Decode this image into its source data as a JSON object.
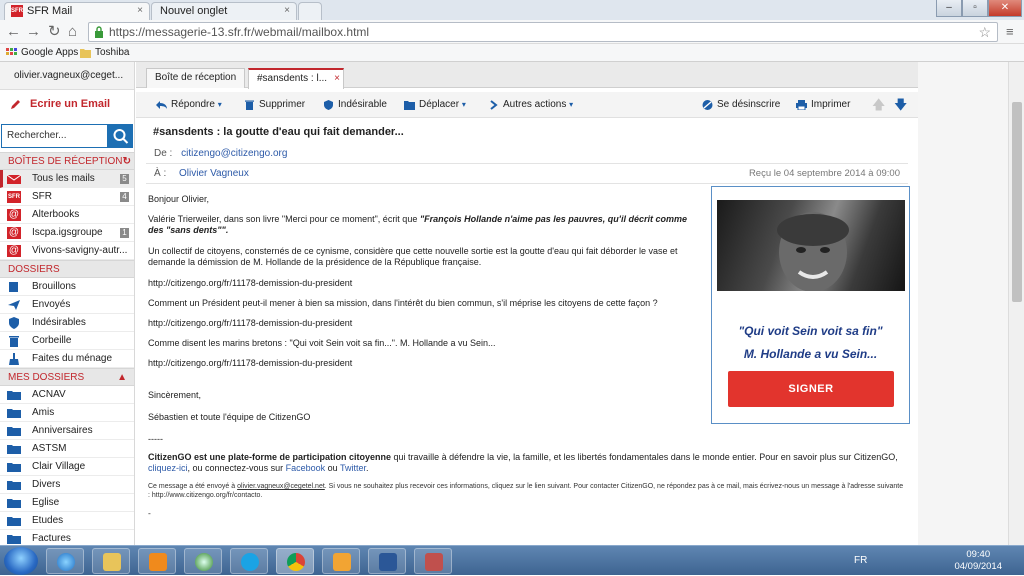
{
  "browser": {
    "tabs": [
      {
        "label": "SFR Mail",
        "favicon": "SFR",
        "close": "×"
      },
      {
        "label": "Nouvel onglet",
        "close": "×"
      }
    ],
    "window_buttons": {
      "minimize": "–",
      "maximize": "▫",
      "close": "✕"
    },
    "url": "https://messagerie-13.sfr.fr/webmail/mailbox.html",
    "bookmarks": [
      "Google Apps",
      "Toshiba"
    ]
  },
  "sidebar": {
    "user": "olivier.vagneux@ceget...",
    "compose": "Ecrire un Email",
    "search_placeholder": "Rechercher...",
    "inbox_header": "BOÎTES DE RÉCEPTION",
    "inboxes": [
      {
        "label": "Tous les mails",
        "count": "5",
        "icon": "all-mail-icon"
      },
      {
        "label": "SFR",
        "count": "4",
        "icon": "sfr-logo-icon"
      },
      {
        "label": "Alterbooks",
        "count": "",
        "icon": "at-icon"
      },
      {
        "label": "Iscpa.igsgroupe",
        "count": "1",
        "icon": "at-icon"
      },
      {
        "label": "Vivons-savigny-autr...",
        "count": "",
        "icon": "at-icon"
      }
    ],
    "folders_header": "DOSSIERS",
    "folders": [
      {
        "label": "Brouillons",
        "icon": "drafts-icon"
      },
      {
        "label": "Envoyés",
        "icon": "sent-icon"
      },
      {
        "label": "Indésirables",
        "icon": "spam-shield-icon"
      },
      {
        "label": "Corbeille",
        "icon": "trash-icon"
      },
      {
        "label": "Faites du ménage",
        "icon": "broom-icon"
      }
    ],
    "my_folders_header": "MES DOSSIERS",
    "my_folders": [
      "ACNAV",
      "Amis",
      "Anniversaires",
      "ASTSM",
      "Clair Village",
      "Divers",
      "Eglise",
      "Etudes",
      "Factures"
    ]
  },
  "main": {
    "tabs": [
      {
        "label": "Boîte de réception"
      },
      {
        "label": "#sansdents : l...",
        "close": "×"
      }
    ],
    "actions": {
      "reply": "Répondre",
      "delete": "Supprimer",
      "spam": "Indésirable",
      "move": "Déplacer",
      "more": "Autres actions",
      "unsubscribe": "Se désinscrire",
      "print": "Imprimer"
    },
    "subject": "#sansdents : la goutte d'eau qui fait demander...",
    "from_label": "De :",
    "from": "citizengo@citizengo.org",
    "to_label": "À :",
    "to": "Olivier Vagneux",
    "received": "Reçu le 04 septembre 2014 à 09:00",
    "body": {
      "greeting": "Bonjour Olivier,",
      "p1_start": "Valérie Trierweiler, dans son livre \"Merci pour ce moment\", écrit que ",
      "p1_quote": "\"François Hollande n'aime pas les pauvres, qu'il décrit comme des \"sans dents\"\".",
      "p2": "Un collectif de citoyens, consternés de ce cynisme, considère que cette nouvelle sortie est la goutte d'eau qui fait déborder le vase et demande la démission de M. Hollande de la présidence de la République française.",
      "link1": "http://citizengo.org/fr/11178-demission-du-president",
      "p3": "Comment un Président peut-il mener à bien sa mission, dans l'intérêt du bien commun, s'il méprise les citoyens de cette façon ?",
      "link2": "http://citizengo.org/fr/11178-demission-du-president",
      "p4": "Comme disent les marins bretons : \"Qui voit Sein voit sa fin...\". M. Hollande a vu Sein...",
      "link3": "http://citizengo.org/fr/11178-demission-du-president",
      "closing": "Sincèrement,",
      "signature": "Sébastien et toute l'équipe de CitizenGO",
      "separator": "-----",
      "footer_bold": "CitizenGO est une plate-forme de participation citoyenne",
      "footer_text": " qui travaille à défendre la vie, la famille, et les libertés fondamentales dans le monde entier. Pour en savoir plus sur CitizenGO, ",
      "footer_link1": "cliquez-ici",
      "footer_text2": ",  ou connectez-vous sur ",
      "footer_link2": "Facebook",
      "footer_text3": " ou ",
      "footer_link3": "Twitter",
      "footer_end": ".",
      "legal_start": "Ce message a été envoyé à ",
      "legal_email": "olivier.vagneux@cegetel.net",
      "legal_rest": ". Si vous ne souhaitez plus recevoir ces informations, cliquez sur le lien suivant. Pour contacter CitizenGO, ne répondez pas à ce mail, mais écrivez-nous un message à l'adresse suivante : http://www.citizengo.org/fr/contacto.",
      "dash": "-"
    },
    "promo": {
      "quote1": "\"Qui voit Sein voit sa fin\"",
      "quote2": "M. Hollande a vu Sein...",
      "button": "SIGNER"
    }
  },
  "taskbar": {
    "lang": "FR",
    "time": "09:40",
    "date": "04/09/2014"
  },
  "colors": {
    "accent": "#c2272d",
    "link": "#2d5aa8",
    "button_red": "#e2342d",
    "search_blue": "#1d6fb3"
  }
}
